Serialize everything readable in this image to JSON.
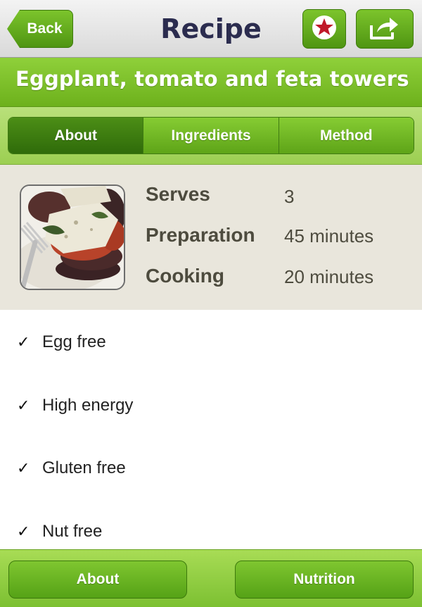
{
  "navbar": {
    "back_label": "Back",
    "title": "Recipe",
    "favorite_icon": "star-icon",
    "share_icon": "share-arrow-icon"
  },
  "recipe": {
    "title": "Eggplant, tomato and feta towers"
  },
  "tabs": [
    {
      "label": "About",
      "active": true
    },
    {
      "label": "Ingredients",
      "active": false
    },
    {
      "label": "Method",
      "active": false
    }
  ],
  "info": {
    "serves_label": "Serves",
    "serves_value": "3",
    "prep_label": "Preparation",
    "prep_value": "45 minutes",
    "cook_label": "Cooking",
    "cook_value": "20 minutes"
  },
  "checklist": {
    "check_glyph": "✓",
    "items": [
      "Egg free",
      "High energy",
      "Gluten free",
      "Nut free"
    ]
  },
  "bottom": {
    "about_label": "About",
    "nutrition_label": "Nutrition"
  },
  "colors": {
    "brand_green": "#6db11c",
    "dark_green": "#2f6b0a",
    "title_navy": "#2b2c4f",
    "star_red": "#c0192a"
  }
}
